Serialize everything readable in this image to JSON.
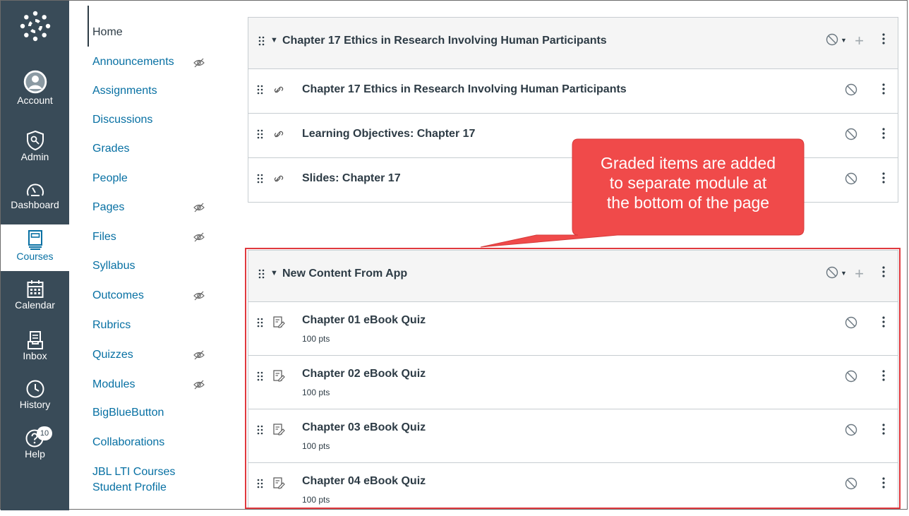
{
  "global_nav": {
    "items": [
      {
        "label": "Account",
        "icon": "account-icon"
      },
      {
        "label": "Admin",
        "icon": "admin-shield-icon"
      },
      {
        "label": "Dashboard",
        "icon": "dashboard-icon"
      },
      {
        "label": "Courses",
        "icon": "courses-icon",
        "active": true
      },
      {
        "label": "Calendar",
        "icon": "calendar-icon"
      },
      {
        "label": "Inbox",
        "icon": "inbox-icon"
      },
      {
        "label": "History",
        "icon": "history-icon"
      },
      {
        "label": "Help",
        "icon": "help-icon",
        "badge": "10"
      }
    ]
  },
  "course_nav": {
    "items": [
      {
        "label": "Home",
        "hidden": false,
        "current": true
      },
      {
        "label": "Announcements",
        "hidden": true
      },
      {
        "label": "Assignments",
        "hidden": false
      },
      {
        "label": "Discussions",
        "hidden": false
      },
      {
        "label": "Grades",
        "hidden": false
      },
      {
        "label": "People",
        "hidden": false
      },
      {
        "label": "Pages",
        "hidden": true
      },
      {
        "label": "Files",
        "hidden": true
      },
      {
        "label": "Syllabus",
        "hidden": false
      },
      {
        "label": "Outcomes",
        "hidden": true
      },
      {
        "label": "Rubrics",
        "hidden": false
      },
      {
        "label": "Quizzes",
        "hidden": true
      },
      {
        "label": "Modules",
        "hidden": true
      },
      {
        "label": "BigBlueButton",
        "hidden": false
      },
      {
        "label": "Collaborations",
        "hidden": false
      },
      {
        "label": "JBL LTI Courses",
        "label2": "Student Profile",
        "hidden": false
      }
    ]
  },
  "modules": [
    {
      "title": "Chapter 17 Ethics in Research Involving Human Participants",
      "items": [
        {
          "title": "Chapter 17 Ethics in Research Involving Human Participants",
          "type": "link-icon"
        },
        {
          "title": "Learning Objectives: Chapter 17",
          "type": "link-icon"
        },
        {
          "title": "Slides: Chapter 17",
          "type": "link-icon"
        }
      ]
    },
    {
      "title": "New Content From App",
      "items": [
        {
          "title": "Chapter 01 eBook Quiz",
          "points": "100 pts",
          "type": "quiz-icon"
        },
        {
          "title": "Chapter 02 eBook Quiz",
          "points": "100 pts",
          "type": "quiz-icon"
        },
        {
          "title": "Chapter 03 eBook Quiz",
          "points": "100 pts",
          "type": "quiz-icon"
        },
        {
          "title": "Chapter 04 eBook Quiz",
          "points": "100 pts",
          "type": "quiz-icon"
        }
      ]
    }
  ],
  "callout": {
    "line1": "Graded items are added",
    "line2": "to separate module at",
    "line3": "the bottom of the page"
  },
  "colors": {
    "callout": "#f04a4a",
    "highlight_border": "#e0393e",
    "nav_bg": "#394b58",
    "link": "#0770a3"
  }
}
